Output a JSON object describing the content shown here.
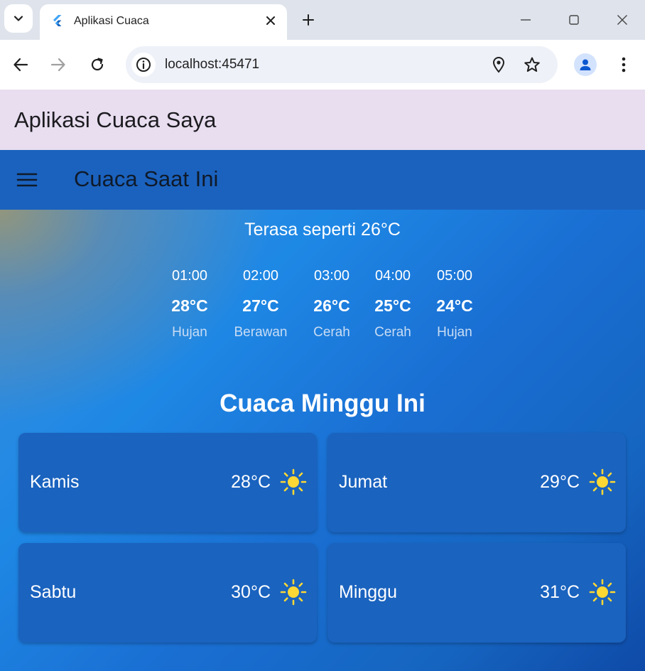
{
  "browser": {
    "tab_title": "Aplikasi Cuaca",
    "url": "localhost:45471"
  },
  "app": {
    "header_title": "Aplikasi Cuaca Saya",
    "appbar_title": "Cuaca Saat Ini",
    "feels_like": "Terasa seperti 26°C",
    "hourly": [
      {
        "time": "01:00",
        "temp": "28°C",
        "condition": "Hujan"
      },
      {
        "time": "02:00",
        "temp": "27°C",
        "condition": "Berawan"
      },
      {
        "time": "03:00",
        "temp": "26°C",
        "condition": "Cerah"
      },
      {
        "time": "04:00",
        "temp": "25°C",
        "condition": "Cerah"
      },
      {
        "time": "05:00",
        "temp": "24°C",
        "condition": "Hujan"
      }
    ],
    "week_title": "Cuaca Minggu Ini",
    "week": [
      {
        "day": "Kamis",
        "temp": "28°C",
        "icon": "sun-icon"
      },
      {
        "day": "Jumat",
        "temp": "29°C",
        "icon": "sun-icon"
      },
      {
        "day": "Sabtu",
        "temp": "30°C",
        "icon": "sun-icon"
      },
      {
        "day": "Minggu",
        "temp": "31°C",
        "icon": "sun-icon"
      }
    ]
  },
  "colors": {
    "accent": "#1b62be",
    "header_bg": "#e8def0",
    "sun": "#fdd835"
  }
}
